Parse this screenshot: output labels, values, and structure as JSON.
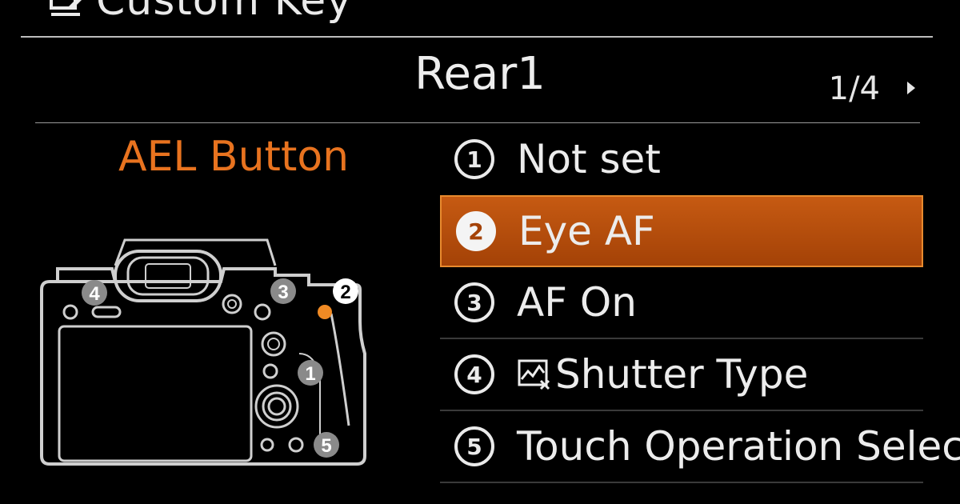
{
  "header": {
    "title": "Custom Key",
    "title_icon": "custom-key-icon"
  },
  "section": {
    "heading": "Rear1",
    "page_indicator": "1/4"
  },
  "selected_button": "AEL Button",
  "diagram": {
    "markers": [
      "4",
      "3",
      "2",
      "1",
      "5"
    ]
  },
  "options": [
    {
      "num": "1",
      "label": "Not set",
      "icon": null
    },
    {
      "num": "2",
      "label": "Eye AF",
      "icon": null
    },
    {
      "num": "3",
      "label": "AF On",
      "icon": null
    },
    {
      "num": "4",
      "label": "Shutter Type",
      "icon": "shutter-type-icon"
    },
    {
      "num": "5",
      "label": "Touch Operation Select",
      "icon": null
    }
  ],
  "colors": {
    "accent": "#e8731f",
    "selected_bg": "#b34c0c"
  }
}
